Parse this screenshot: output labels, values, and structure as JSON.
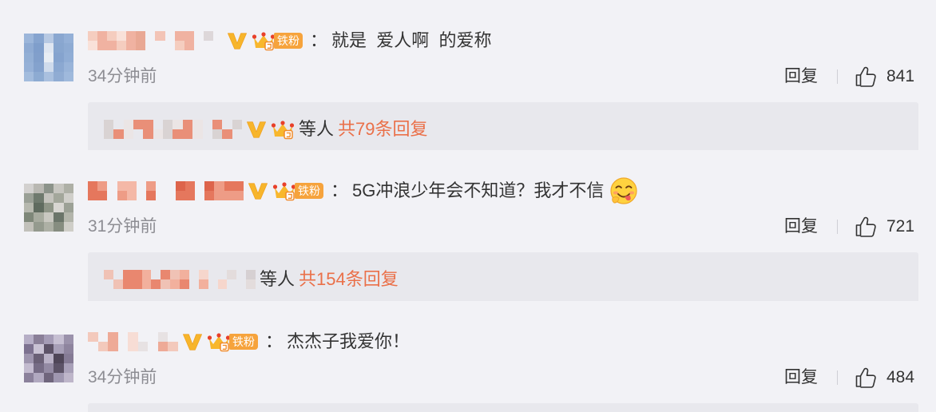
{
  "colors": {
    "background": "#f2f2f6",
    "thread_box": "#e8e8ed",
    "accent": "#ea7049",
    "text": "#333333",
    "muted": "#8d8d93",
    "verified": "#f7b52b",
    "fan_badge": "#f6a33c"
  },
  "icons": {
    "verified": "verified-v-icon",
    "fan_crown": "crown-icon",
    "like": "thumbs-up-icon",
    "emoji": "yum-emoji-icon"
  },
  "comments": [
    {
      "fan_label": "铁粉",
      "separator": "：",
      "text": "就是  爱人啊  的爱称",
      "time": "34分钟前",
      "reply_label": "回复",
      "likes": "841",
      "thread": {
        "suffix": "等人",
        "count_text": "共79条回复"
      }
    },
    {
      "fan_label": "铁粉",
      "separator": "：",
      "text": "5G冲浪少年会不知道？我才不信",
      "emoji": "yum-emoji-icon",
      "time": "31分钟前",
      "reply_label": "回复",
      "likes": "721",
      "thread": {
        "suffix": "等人",
        "count_text": "共154条回复"
      }
    },
    {
      "fan_label": "铁粉",
      "separator": "：",
      "text": "杰杰子我爱你！",
      "time": "34分钟前",
      "reply_label": "回复",
      "likes": "484"
    }
  ]
}
